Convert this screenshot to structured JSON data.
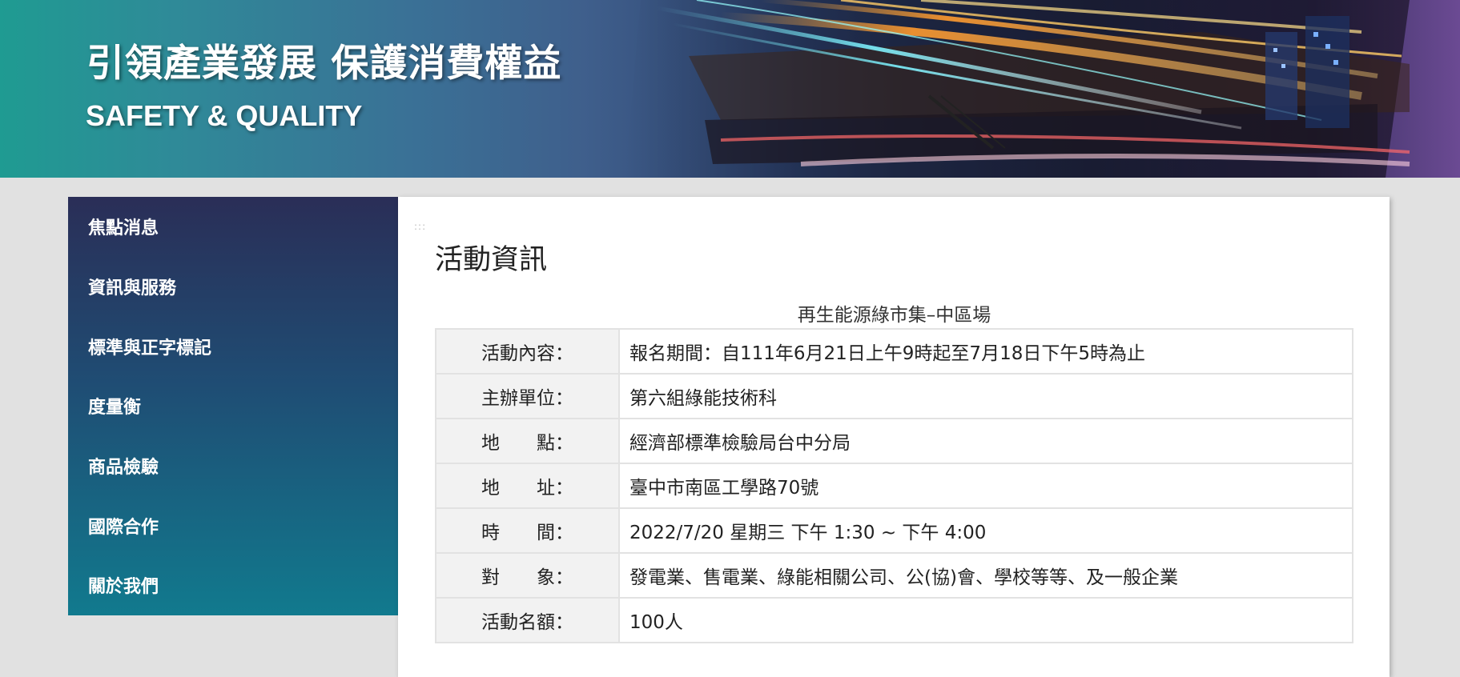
{
  "banner": {
    "title": "引領產業發展 保護消費權益",
    "subtitle": "SAFETY & QUALITY"
  },
  "sidebar": {
    "items": [
      {
        "label": "焦點消息"
      },
      {
        "label": "資訊與服務"
      },
      {
        "label": "標準與正字標記"
      },
      {
        "label": "度量衡"
      },
      {
        "label": "商品檢驗"
      },
      {
        "label": "國際合作"
      },
      {
        "label": "關於我們"
      }
    ]
  },
  "main": {
    "accesskey": ":::",
    "title": "活動資訊",
    "caption": "再生能源綠市集–中區場",
    "rows": [
      {
        "label": "活動內容：",
        "value": "報名期間：自111年6月21日上午9時起至7月18日下午5時為止"
      },
      {
        "label": "主辦單位：",
        "value": "第六組綠能技術科"
      },
      {
        "label": "地　　點：",
        "value": "經濟部標準檢驗局台中分局"
      },
      {
        "label": "地　　址：",
        "value": "臺中市南區工學路70號"
      },
      {
        "label": "時　　間：",
        "value": "2022/7/20 星期三 下午 1:30 ~ 下午 4:00"
      },
      {
        "label": "對　　象：",
        "value": "發電業、售電業、綠能相關公司、公(協)會、學校等等、及一般企業"
      },
      {
        "label": "活動名額：",
        "value": "100人"
      }
    ]
  },
  "colors": {
    "background": "#e1e1e1",
    "sidebar_top": "#2a2e57",
    "sidebar_bottom": "#117a8e",
    "label_cell": "#f2f2f2",
    "border": "#e2e2e2"
  }
}
